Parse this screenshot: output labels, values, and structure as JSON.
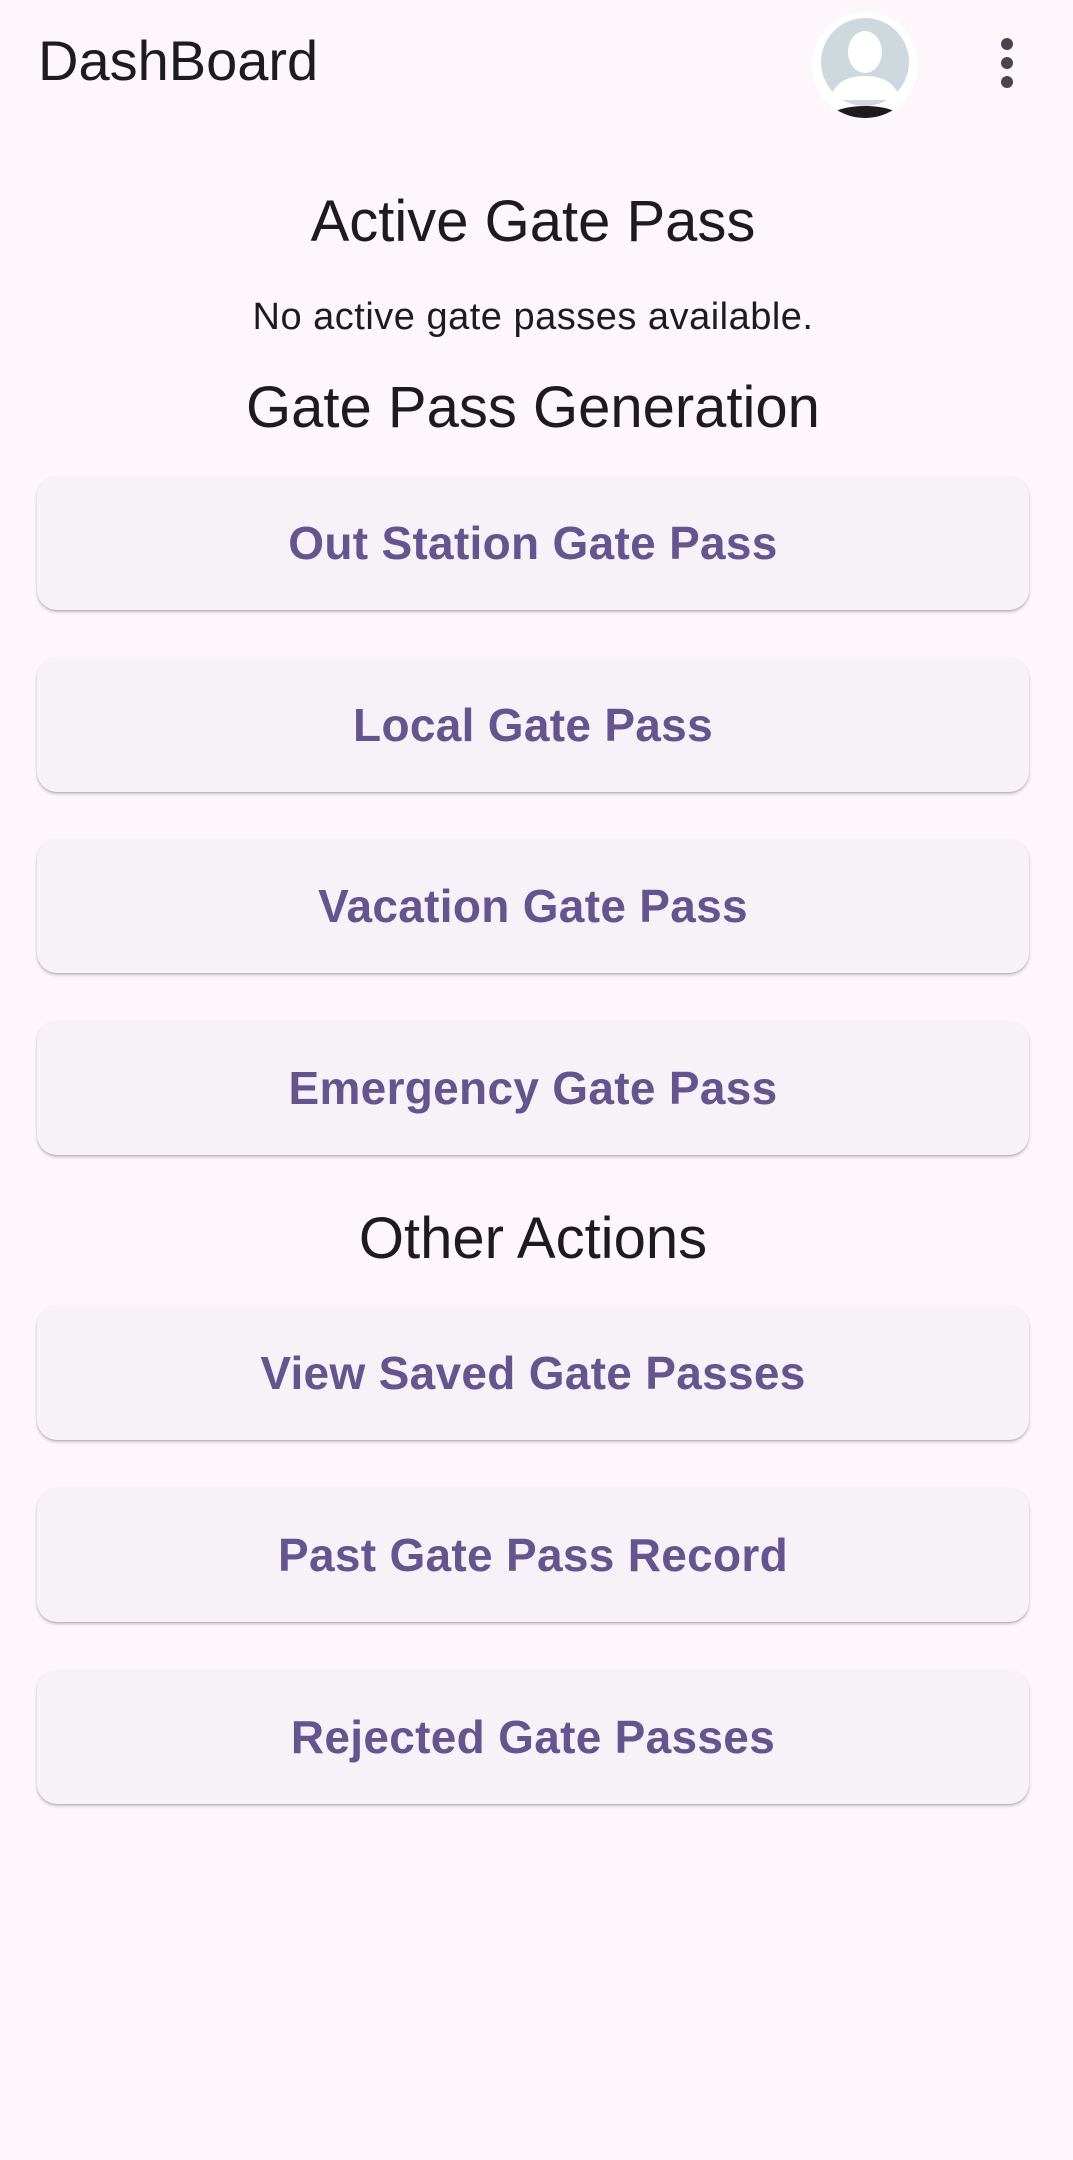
{
  "app_bar": {
    "title": "DashBoard",
    "avatar_icon": "avatar-placeholder-icon",
    "menu_icon": "more-vert-icon"
  },
  "active_section": {
    "title": "Active Gate Pass",
    "empty_message": "No active gate passes available."
  },
  "generation_section": {
    "title": "Gate Pass Generation",
    "buttons": [
      {
        "label": "Out Station Gate Pass"
      },
      {
        "label": "Local Gate Pass"
      },
      {
        "label": "Vacation Gate Pass"
      },
      {
        "label": "Emergency Gate Pass"
      }
    ]
  },
  "other_section": {
    "title": "Other Actions",
    "buttons": [
      {
        "label": "View Saved Gate Passes"
      },
      {
        "label": "Past Gate Pass Record"
      },
      {
        "label": "Rejected Gate Passes"
      }
    ]
  },
  "colors": {
    "background": "#FDF7FC",
    "button_surface": "#F7F2F8",
    "button_text": "#65558F",
    "text_primary": "#1D1B20"
  }
}
